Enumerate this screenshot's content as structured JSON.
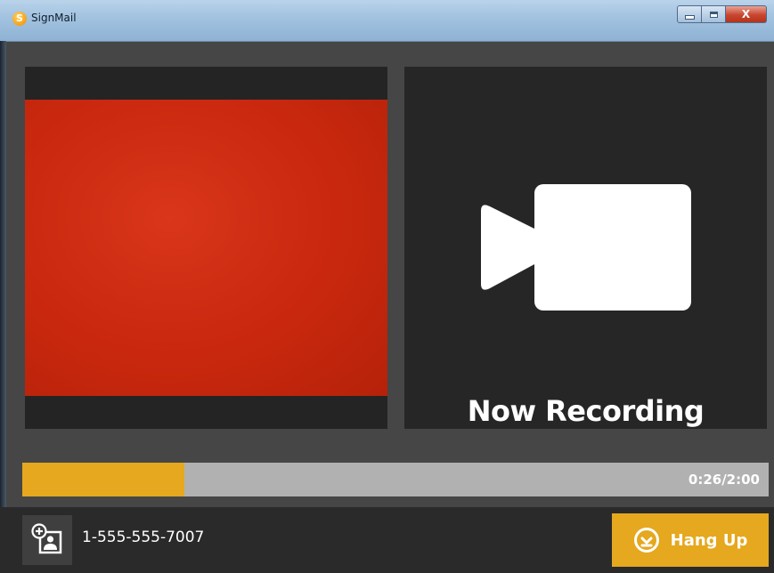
{
  "window": {
    "title": "SignMail",
    "app_icon_glyph": "S",
    "close_glyph": "X"
  },
  "icons": {
    "app": "signmail-logo-icon",
    "camera": "video-camera-icon",
    "contact": "add-contact-icon",
    "hangup": "download-circle-icon"
  },
  "colors": {
    "accent": "#e5a81e",
    "self_view": "#c9280e",
    "panel": "#262626",
    "progress_track": "#b1b1b1"
  },
  "recording": {
    "status_label": "Now Recording"
  },
  "progress": {
    "elapsed": "0:26",
    "total": "2:00",
    "label": "0:26/2:00",
    "fraction": 0.2167
  },
  "call": {
    "phone_number": "1-555-555-7007",
    "hangup_label": "Hang Up"
  }
}
